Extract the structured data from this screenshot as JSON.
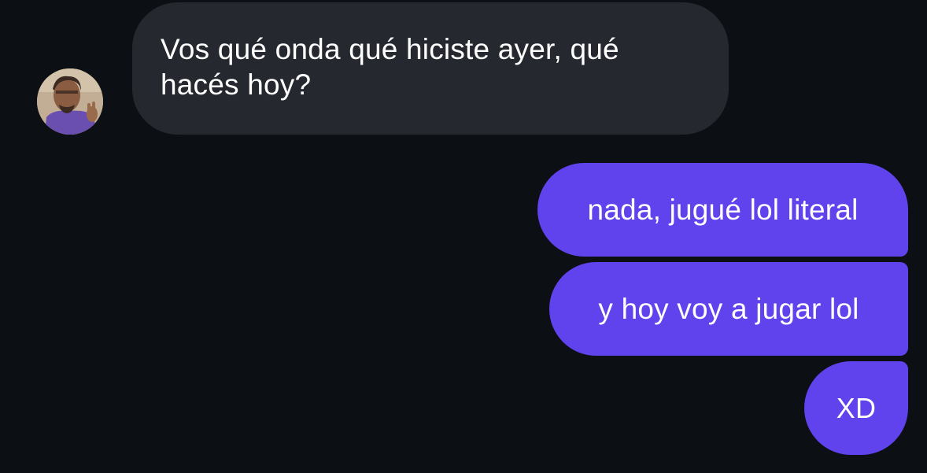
{
  "conversation": {
    "incoming": {
      "avatar": {
        "icon": "user-avatar-photo"
      },
      "message_line1": "Vos qué onda qué hiciste ayer, qué",
      "message_line2": "hacés hoy?"
    },
    "outgoing": [
      {
        "text": "nada, jugué lol literal"
      },
      {
        "text": "y hoy voy a jugar lol"
      },
      {
        "text": "XD"
      }
    ]
  },
  "colors": {
    "background": "#0c0f14",
    "incoming_bubble": "#25282e",
    "outgoing_bubble": "#6043ec",
    "text": "#ffffff"
  }
}
